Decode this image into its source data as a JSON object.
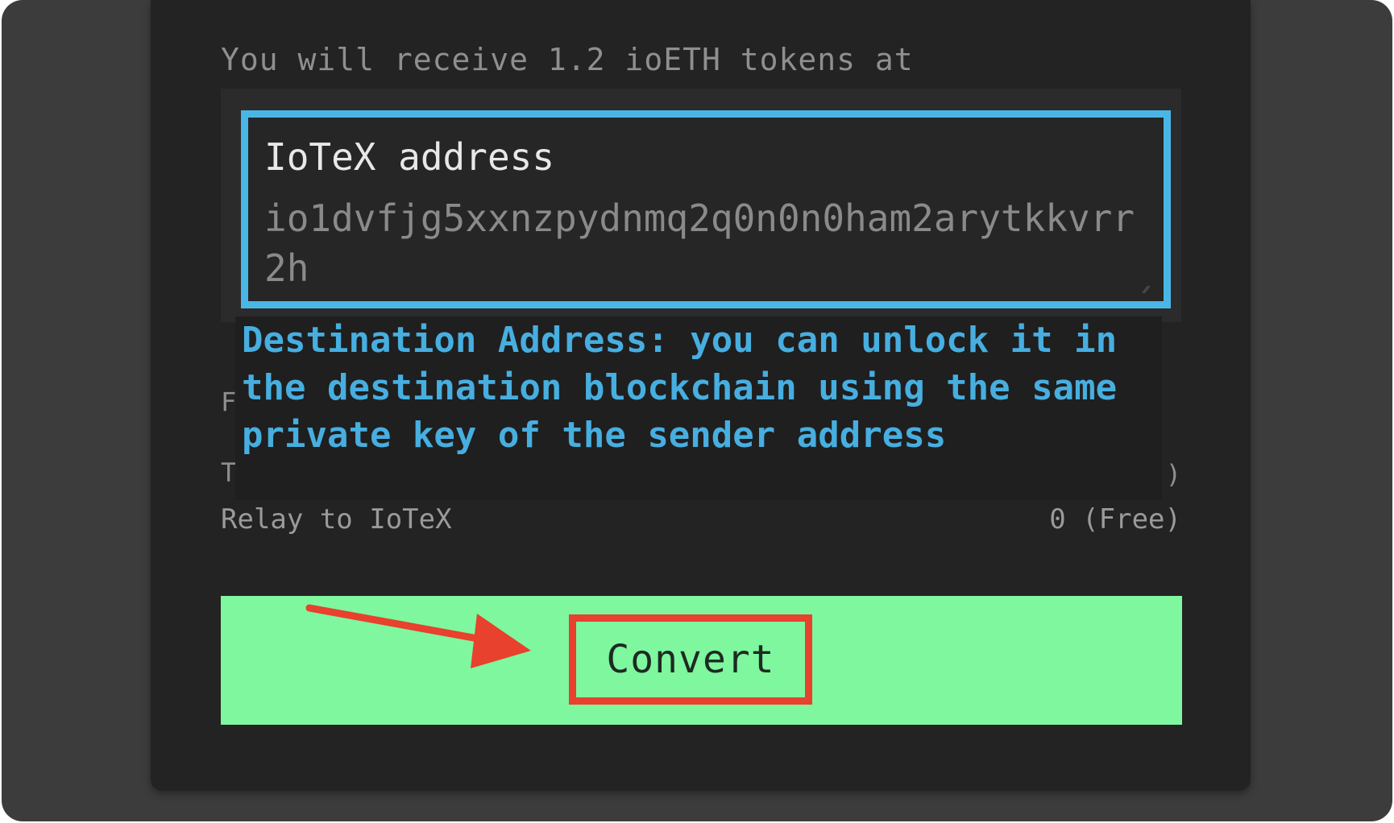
{
  "receive": {
    "text": "You will receive 1.2 ioETH tokens at"
  },
  "address_field": {
    "label": "IoTeX address",
    "value": "io1dvfjg5xxnzpydnmq2q0n0n0ham2arytkkvrr2h"
  },
  "tooltip": {
    "text": "Destination Address: you can unlock it in the destination blockchain using the same private key of the sender address"
  },
  "hidden_rows": {
    "left_1": "F",
    "left_2": "T",
    "right": ")"
  },
  "fee": {
    "label": "Relay to IoTeX",
    "value": "0 (Free)"
  },
  "action": {
    "convert_label": "Convert"
  },
  "colors": {
    "accent_blue": "#4ab6e6",
    "convert_green": "#7ef79f",
    "highlight_red": "#e8412d"
  },
  "icons": {
    "arrow": "right-arrow-icon",
    "resize": "resize-handle-icon"
  }
}
